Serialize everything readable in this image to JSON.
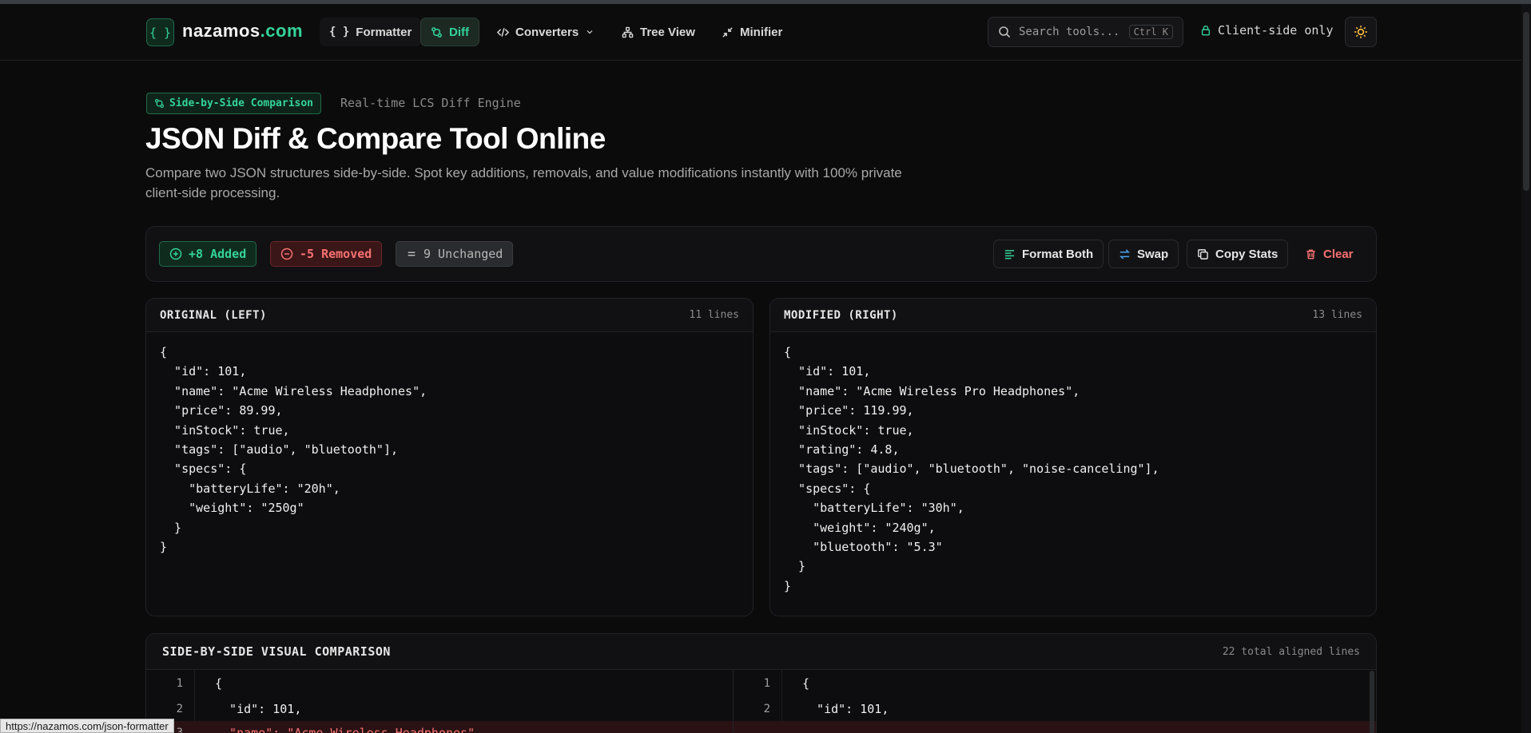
{
  "brand": {
    "name": "nazamos",
    "tld": ".com",
    "logo_glyph": "{ }"
  },
  "nav": [
    {
      "label": "Formatter",
      "icon": "braces-icon"
    },
    {
      "label": "Diff",
      "icon": "git-compare-icon",
      "active": true
    },
    {
      "label": "Converters",
      "icon": "code-icon",
      "dropdown": true
    },
    {
      "label": "Tree View",
      "icon": "tree-icon"
    },
    {
      "label": "Minifier",
      "icon": "minimize-icon"
    }
  ],
  "search": {
    "placeholder": "Search tools...",
    "shortcut": "Ctrl K"
  },
  "client_only": "Client-side only",
  "hero": {
    "badge": "Side-by-Side Comparison",
    "engine": "Real-time LCS Diff Engine",
    "title": "JSON Diff & Compare Tool Online",
    "description": "Compare two JSON structures side-by-side. Spot key additions, removals, and value modifications instantly with 100% private client-side processing."
  },
  "stats": {
    "added": "+8 Added",
    "removed": "-5 Removed",
    "unchanged": "9 Unchanged"
  },
  "actions": {
    "format_both": "Format Both",
    "swap": "Swap",
    "copy_stats": "Copy Stats",
    "clear": "Clear"
  },
  "left_editor": {
    "title": "ORIGINAL (LEFT)",
    "lines_label": "11 lines",
    "code": "{\n  \"id\": 101,\n  \"name\": \"Acme Wireless Headphones\",\n  \"price\": 89.99,\n  \"inStock\": true,\n  \"tags\": [\"audio\", \"bluetooth\"],\n  \"specs\": {\n    \"batteryLife\": \"20h\",\n    \"weight\": \"250g\"\n  }\n}"
  },
  "right_editor": {
    "title": "MODIFIED (RIGHT)",
    "lines_label": "13 lines",
    "code": "{\n  \"id\": 101,\n  \"name\": \"Acme Wireless Pro Headphones\",\n  \"price\": 119.99,\n  \"inStock\": true,\n  \"rating\": 4.8,\n  \"tags\": [\"audio\", \"bluetooth\", \"noise-canceling\"],\n  \"specs\": {\n    \"batteryLife\": \"30h\",\n    \"weight\": \"240g\",\n    \"bluetooth\": \"5.3\"\n  }\n}"
  },
  "comparison": {
    "title": "SIDE-BY-SIDE VISUAL COMPARISON",
    "meta": "22 total aligned lines",
    "left_rows": [
      {
        "ln": "1",
        "text": "{"
      },
      {
        "ln": "2",
        "text": "  \"id\": 101,"
      },
      {
        "ln": "3",
        "marker": "-",
        "text": "  \"name\": \"Acme Wireless Headphones\",",
        "removed": true
      }
    ],
    "right_rows": [
      {
        "ln": "1",
        "text": "{"
      },
      {
        "ln": "2",
        "text": "  \"id\": 101,"
      },
      {
        "ln": "",
        "text": "",
        "removed": true
      }
    ]
  },
  "status_url": "https://nazamos.com/json-formatter",
  "colors": {
    "accent": "#34d399",
    "danger": "#f87171",
    "background": "#0b0b0c"
  }
}
